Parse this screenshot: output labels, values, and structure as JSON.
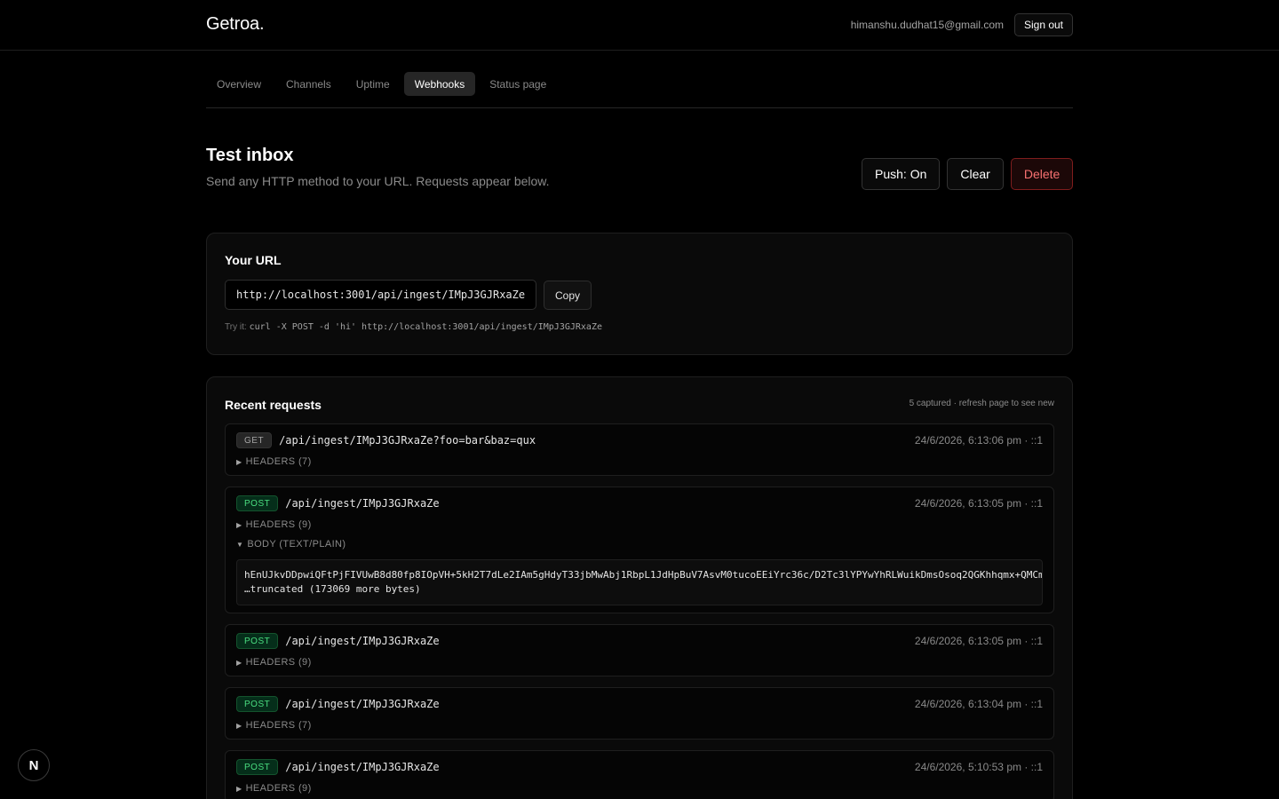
{
  "header": {
    "brand": "Getroa.",
    "user_email": "himanshu.dudhat15@gmail.com",
    "sign_out": "Sign out"
  },
  "nav": {
    "tabs": [
      {
        "label": "Overview",
        "active": false
      },
      {
        "label": "Channels",
        "active": false
      },
      {
        "label": "Uptime",
        "active": false
      },
      {
        "label": "Webhooks",
        "active": true
      },
      {
        "label": "Status page",
        "active": false
      }
    ]
  },
  "page": {
    "title": "Test inbox",
    "subtitle": "Send any HTTP method to your URL. Requests appear below.",
    "push_label": "Push: On",
    "clear_label": "Clear",
    "delete_label": "Delete"
  },
  "url_card": {
    "title": "Your URL",
    "url": "http://localhost:3001/api/ingest/IMpJ3GJRxaZe",
    "copy_label": "Copy",
    "try_label": "Try it:",
    "try_cmd": "curl -X POST -d 'hi' http://localhost:3001/api/ingest/IMpJ3GJRxaZe"
  },
  "requests": {
    "title": "Recent requests",
    "meta": "5 captured · refresh page to see new",
    "items": [
      {
        "method": "GET",
        "path": "/api/ingest/IMpJ3GJRxaZe?foo=bar&baz=qux",
        "time": "24/6/2026, 6:13:06 pm · ::1",
        "headers": "HEADERS (7)"
      },
      {
        "method": "POST",
        "path": "/api/ingest/IMpJ3GJRxaZe",
        "time": "24/6/2026, 6:13:05 pm · ::1",
        "headers": "HEADERS (9)",
        "body_label": "BODY (TEXT/PLAIN)",
        "body_line1": "hEnUJkvDDpwiQFtPjFIVUwB8d80fp8IOpVH+5kH2T7dLe2IAm5gHdyT33jbMwAbj1RbpL1JdHpBuV7AsvM0tucoEEiYrc36c/D2Tc3lYPYwYhRLWuikDmsOsoq2QGKhhqmx+QMCm",
        "body_line2": "…truncated (173069 more bytes)"
      },
      {
        "method": "POST",
        "path": "/api/ingest/IMpJ3GJRxaZe",
        "time": "24/6/2026, 6:13:05 pm · ::1",
        "headers": "HEADERS (9)"
      },
      {
        "method": "POST",
        "path": "/api/ingest/IMpJ3GJRxaZe",
        "time": "24/6/2026, 6:13:04 pm · ::1",
        "headers": "HEADERS (7)"
      },
      {
        "method": "POST",
        "path": "/api/ingest/IMpJ3GJRxaZe",
        "time": "24/6/2026, 5:10:53 pm · ::1",
        "headers": "HEADERS (9)"
      }
    ]
  },
  "badge": {
    "letter": "N"
  },
  "icons": {
    "collapsed": "triangle-right-icon",
    "expanded": "triangle-down-icon",
    "dev_badge": "nextjs-icon"
  }
}
